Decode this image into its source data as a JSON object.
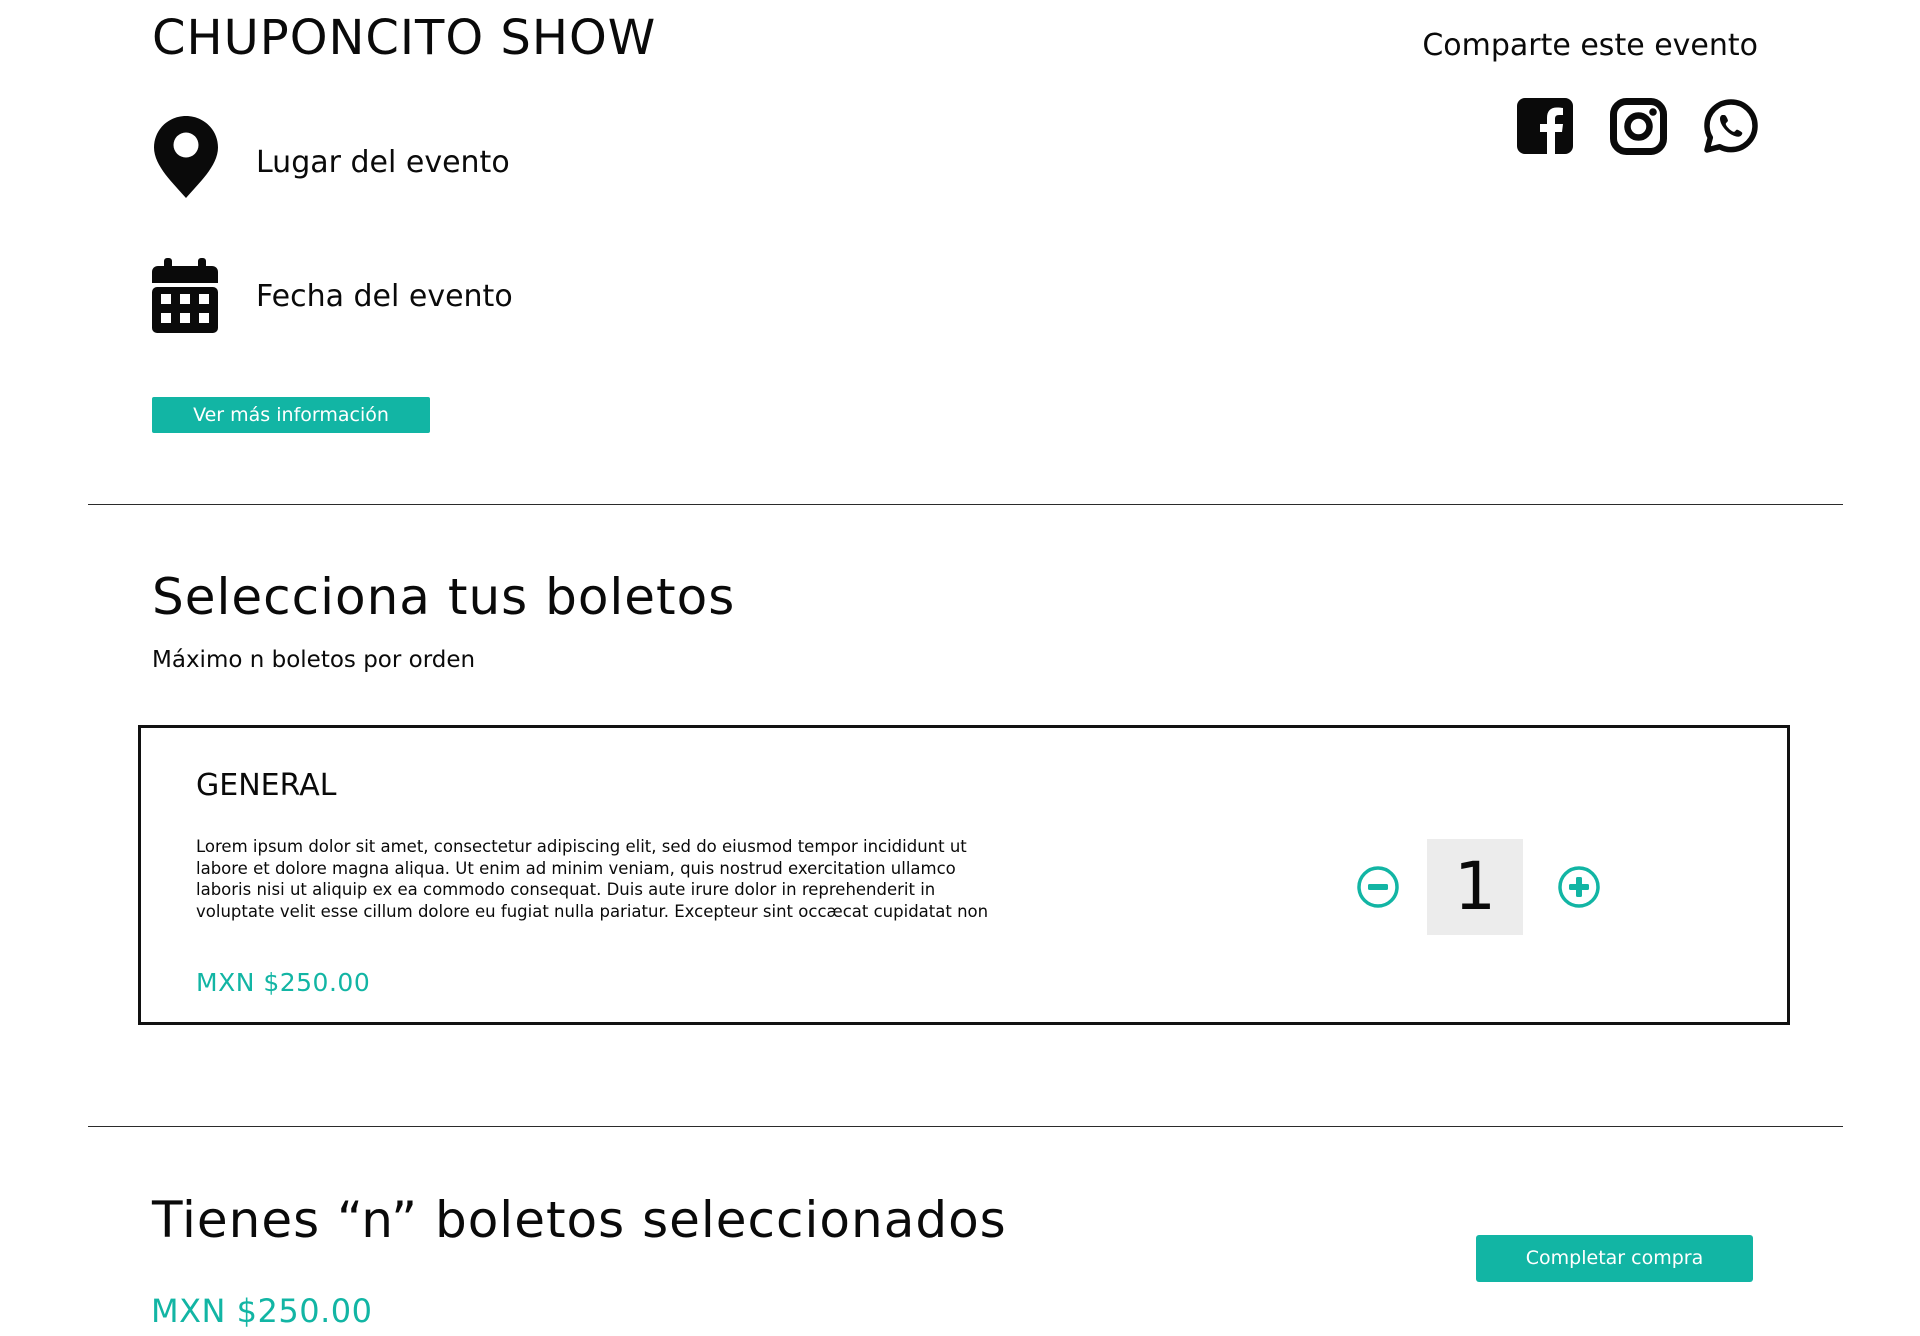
{
  "event": {
    "title": "CHUPONCITO SHOW",
    "venue_label": "Lugar del evento",
    "date_label": "Fecha del evento",
    "more_info_button": "Ver más información"
  },
  "share": {
    "label": "Comparte este evento",
    "networks": [
      "facebook-icon",
      "instagram-icon",
      "whatsapp-icon"
    ]
  },
  "tickets_section": {
    "title": "Selecciona tus boletos",
    "subtitle": "Máximo n boletos por orden",
    "tickets": [
      {
        "name": "GENERAL",
        "description": "Lorem ipsum dolor sit amet, consectetur adipiscing elit, sed do eiusmod tempor incididunt ut labore et dolore magna aliqua. Ut enim ad minim veniam, quis nostrud exercitation ullamco laboris nisi ut aliquip ex ea commodo consequat. Duis aute irure dolor in reprehenderit in voluptate velit esse cillum dolore eu fugiat nulla pariatur. Excepteur sint occæcat cupidatat non",
        "price": "MXN $250.00",
        "quantity": "1"
      }
    ]
  },
  "summary": {
    "title": "Tienes “n” boletos seleccionados",
    "total": "MXN $250.00",
    "complete_button": "Completar compra"
  },
  "colors": {
    "accent": "#12b5a4",
    "text": "#0a0a0a",
    "quantity_bg": "#ececec"
  }
}
